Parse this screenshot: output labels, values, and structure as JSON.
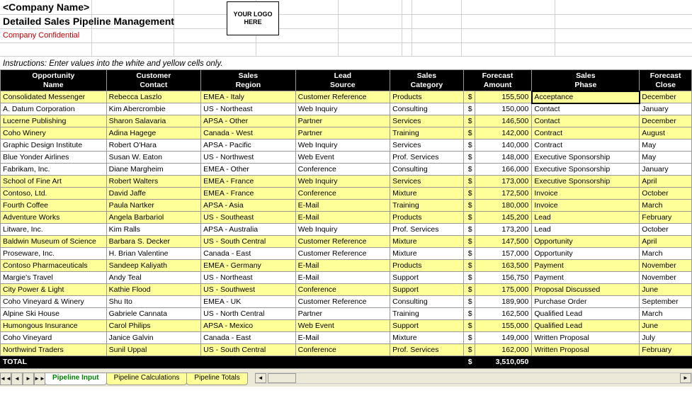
{
  "header": {
    "company_name": "<Company Name>",
    "title": "Detailed Sales Pipeline Management",
    "confidential": "Company Confidential",
    "logo_text": "YOUR LOGO HERE"
  },
  "instructions": "Instructions: Enter values into the white and yellow cells only.",
  "columns": [
    {
      "line1": "Opportunity",
      "line2": "Name"
    },
    {
      "line1": "Customer",
      "line2": "Contact"
    },
    {
      "line1": "Sales",
      "line2": "Region"
    },
    {
      "line1": "Lead",
      "line2": "Source"
    },
    {
      "line1": "Sales",
      "line2": "Category"
    },
    {
      "line1": "Forecast",
      "line2": "Amount"
    },
    {
      "line1": "Sales",
      "line2": "Phase"
    },
    {
      "line1": "Forecast",
      "line2": "Close"
    }
  ],
  "rows": [
    {
      "name": "Consolidated Messenger",
      "contact": "Rebecca Laszlo",
      "region": "EMEA - Italy",
      "lead": "Customer Reference",
      "category": "Products",
      "amount": "155,500",
      "phase": "Acceptance",
      "close": "December",
      "yellow": true
    },
    {
      "name": "A. Datum Corporation",
      "contact": "Kim Abercrombie",
      "region": "US - Northeast",
      "lead": "Web Inquiry",
      "category": "Consulting",
      "amount": "150,000",
      "phase": "Contact",
      "close": "January",
      "yellow": false
    },
    {
      "name": "Lucerne Publishing",
      "contact": "Sharon Salavaria",
      "region": "APSA - Other",
      "lead": "Partner",
      "category": "Services",
      "amount": "146,500",
      "phase": "Contact",
      "close": "December",
      "yellow": true
    },
    {
      "name": "Coho Winery",
      "contact": "Adina Hagege",
      "region": "Canada - West",
      "lead": "Partner",
      "category": "Training",
      "amount": "142,000",
      "phase": "Contract",
      "close": "August",
      "yellow": true
    },
    {
      "name": "Graphic Design Institute",
      "contact": "Robert O'Hara",
      "region": "APSA - Pacific",
      "lead": "Web Inquiry",
      "category": "Services",
      "amount": "140,000",
      "phase": "Contract",
      "close": "May",
      "yellow": false
    },
    {
      "name": "Blue Yonder Airlines",
      "contact": "Susan W. Eaton",
      "region": "US - Northwest",
      "lead": "Web Event",
      "category": "Prof. Services",
      "amount": "148,000",
      "phase": "Executive Sponsorship",
      "close": "May",
      "yellow": false
    },
    {
      "name": "Fabrikam, Inc.",
      "contact": "Diane Margheim",
      "region": "EMEA - Other",
      "lead": "Conference",
      "category": "Consulting",
      "amount": "166,000",
      "phase": "Executive Sponsorship",
      "close": "January",
      "yellow": false
    },
    {
      "name": "School of Fine Art",
      "contact": "Robert Walters",
      "region": "EMEA - France",
      "lead": "Web Inquiry",
      "category": "Services",
      "amount": "173,000",
      "phase": "Executive Sponsorship",
      "close": "April",
      "yellow": true
    },
    {
      "name": "Contoso, Ltd.",
      "contact": "David Jaffe",
      "region": "EMEA - France",
      "lead": "Conference",
      "category": "Mixture",
      "amount": "172,500",
      "phase": "Invoice",
      "close": "October",
      "yellow": true
    },
    {
      "name": "Fourth Coffee",
      "contact": "Paula Nartker",
      "region": "APSA - Asia",
      "lead": "E-Mail",
      "category": "Training",
      "amount": "180,000",
      "phase": "Invoice",
      "close": "March",
      "yellow": true
    },
    {
      "name": "Adventure Works",
      "contact": "Angela Barbariol",
      "region": "US - Southeast",
      "lead": "E-Mail",
      "category": "Products",
      "amount": "145,200",
      "phase": "Lead",
      "close": "February",
      "yellow": true
    },
    {
      "name": "Litware, Inc.",
      "contact": "Kim Ralls",
      "region": "APSA - Australia",
      "lead": "Web Inquiry",
      "category": "Prof. Services",
      "amount": "173,200",
      "phase": "Lead",
      "close": "October",
      "yellow": false
    },
    {
      "name": "Baldwin Museum of Science",
      "contact": "Barbara S. Decker",
      "region": "US - South Central",
      "lead": "Customer Reference",
      "category": "Mixture",
      "amount": "147,500",
      "phase": "Opportunity",
      "close": "April",
      "yellow": true
    },
    {
      "name": "Proseware, Inc.",
      "contact": "H. Brian Valentine",
      "region": "Canada - East",
      "lead": "Customer Reference",
      "category": "Mixture",
      "amount": "157,000",
      "phase": "Opportunity",
      "close": "March",
      "yellow": false
    },
    {
      "name": "Contoso Pharmaceuticals",
      "contact": "Sandeep Kaliyath",
      "region": "EMEA - Germany",
      "lead": "E-Mail",
      "category": "Products",
      "amount": "163,500",
      "phase": "Payment",
      "close": "November",
      "yellow": true
    },
    {
      "name": "Margie's Travel",
      "contact": "Andy Teal",
      "region": "US - Northeast",
      "lead": "E-Mail",
      "category": "Support",
      "amount": "156,750",
      "phase": "Payment",
      "close": "November",
      "yellow": false
    },
    {
      "name": "City Power & Light",
      "contact": "Kathie Flood",
      "region": "US - Southwest",
      "lead": "Conference",
      "category": "Support",
      "amount": "175,000",
      "phase": "Proposal Discussed",
      "close": "June",
      "yellow": true
    },
    {
      "name": "Coho Vineyard & Winery",
      "contact": "Shu Ito",
      "region": "EMEA - UK",
      "lead": "Customer Reference",
      "category": "Consulting",
      "amount": "189,900",
      "phase": "Purchase Order",
      "close": "September",
      "yellow": false
    },
    {
      "name": "Alpine Ski House",
      "contact": "Gabriele Cannata",
      "region": "US - North Central",
      "lead": "Partner",
      "category": "Training",
      "amount": "162,500",
      "phase": "Qualified Lead",
      "close": "March",
      "yellow": false
    },
    {
      "name": "Humongous Insurance",
      "contact": "Carol Philips",
      "region": "APSA - Mexico",
      "lead": "Web Event",
      "category": "Support",
      "amount": "155,000",
      "phase": "Qualified Lead",
      "close": "June",
      "yellow": true
    },
    {
      "name": "Coho Vineyard",
      "contact": "Janice Galvin",
      "region": "Canada - East",
      "lead": "E-Mail",
      "category": "Mixture",
      "amount": "149,000",
      "phase": "Written Proposal",
      "close": "July",
      "yellow": false
    },
    {
      "name": "Northwind Traders",
      "contact": "Sunil Uppal",
      "region": "US - South Central",
      "lead": "Conference",
      "category": "Prof. Services",
      "amount": "162,000",
      "phase": "Written Proposal",
      "close": "February",
      "yellow": true
    }
  ],
  "total": {
    "label": "TOTAL",
    "amount": "3,510,050"
  },
  "tabs": [
    {
      "label": "Pipeline Input",
      "active": true
    },
    {
      "label": "Pipeline Calculations",
      "active": false
    },
    {
      "label": "Pipeline Totals",
      "active": false
    }
  ],
  "currency_symbol": "$"
}
